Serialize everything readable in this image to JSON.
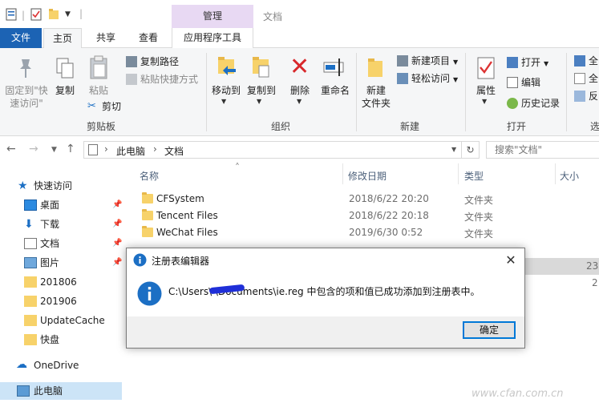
{
  "window": {
    "title": "文档",
    "context_group": "管理"
  },
  "tabs": {
    "file": "文件",
    "home": "主页",
    "share": "共享",
    "view": "查看",
    "app_tools": "应用程序工具"
  },
  "ribbon": {
    "clipboard": {
      "pin_label": "固定到\"快\n速访问\"",
      "copy_label": "复制",
      "paste_label": "粘贴",
      "copy_path": "复制路径",
      "paste_shortcut": "粘贴快捷方式",
      "cut": "剪切",
      "group": "剪贴板"
    },
    "organize": {
      "move_to": "移动到",
      "copy_to": "复制到",
      "delete": "删除",
      "rename": "重命名",
      "group": "组织"
    },
    "new": {
      "new_folder": "新建\n文件夹",
      "new_item": "新建项目",
      "easy_access": "轻松访问",
      "group": "新建"
    },
    "open": {
      "properties": "属性",
      "open": "打开",
      "edit": "编辑",
      "history": "历史记录",
      "group": "打开"
    },
    "select": {
      "sel1": "全",
      "sel2": "全",
      "sel3": "反",
      "group": "选"
    }
  },
  "address": {
    "this_pc": "此电脑",
    "docs": "文档",
    "search_placeholder": "搜索\"文档\""
  },
  "nav": {
    "quick_access": "快速访问",
    "items": [
      {
        "label": "桌面",
        "pinned": true
      },
      {
        "label": "下载",
        "pinned": true
      },
      {
        "label": "文档",
        "pinned": true
      },
      {
        "label": "图片",
        "pinned": true
      },
      {
        "label": "201806",
        "pinned": false
      },
      {
        "label": "201906",
        "pinned": false
      },
      {
        "label": "UpdateCache",
        "pinned": false
      },
      {
        "label": "快盘",
        "pinned": false
      }
    ],
    "onedrive": "OneDrive",
    "this_pc": "此电脑"
  },
  "columns": {
    "name": "名称",
    "date": "修改日期",
    "type": "类型",
    "size": "大小"
  },
  "files": [
    {
      "name": "CFSystem",
      "date": "2018/6/22 20:20",
      "type": "文件夹",
      "size": ""
    },
    {
      "name": "Tencent Files",
      "date": "2018/6/22 20:18",
      "type": "文件夹",
      "size": ""
    },
    {
      "name": "WeChat Files",
      "date": "2019/6/30 0:52",
      "type": "文件夹",
      "size": ""
    },
    {
      "name": "",
      "date": "",
      "type": "",
      "size": "23"
    },
    {
      "name": "",
      "date": "",
      "type": "",
      "size": "2"
    }
  ],
  "dialog": {
    "title": "注册表编辑器",
    "message": "C:\\Users\\        \\Documents\\ie.reg 中包含的项和值已成功添加到注册表中。",
    "ok": "确定"
  },
  "watermark": "www.cfan.com.cn",
  "colors": {
    "accent": "#1c63b4",
    "context": "#e8d9f3",
    "selection": "#cce4f7",
    "info": "#1c6fc4"
  }
}
